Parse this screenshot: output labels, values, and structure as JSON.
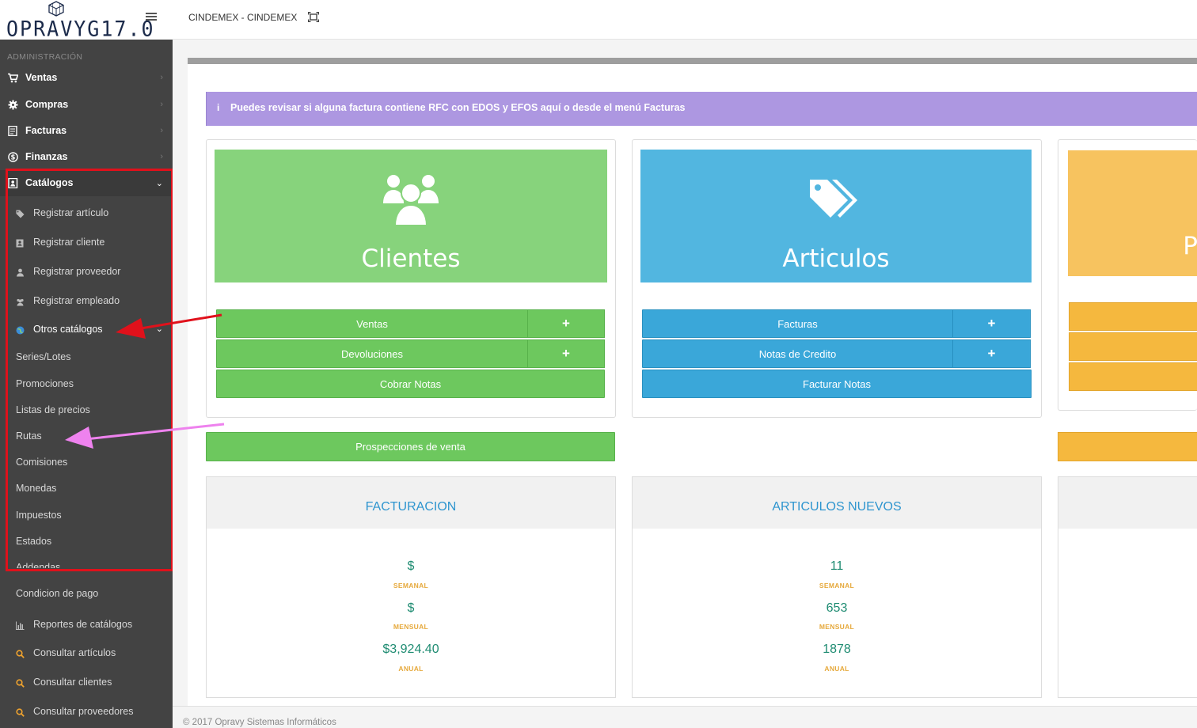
{
  "topbar": {
    "logo_text": "OPRAVYG17.0",
    "company": "CINDEMEX - CINDEMEX",
    "hamburger_icon": "hamburger-menu-icon",
    "fullscreen_icon": "fullscreen-icon"
  },
  "sidebar": {
    "header": "ADMINISTRACIÓN",
    "items": [
      {
        "label": "Ventas",
        "icon": "cart-icon"
      },
      {
        "label": "Compras",
        "icon": "gear-icon"
      },
      {
        "label": "Facturas",
        "icon": "invoice-icon"
      },
      {
        "label": "Finanzas",
        "icon": "dollar-icon"
      },
      {
        "label": "Catálogos",
        "icon": "catalog-icon"
      }
    ],
    "catalog_sub": [
      {
        "label": "Registrar artículo",
        "icon": "tags-icon"
      },
      {
        "label": "Registrar cliente",
        "icon": "address-book-icon"
      },
      {
        "label": "Registrar proveedor",
        "icon": "user-icon"
      },
      {
        "label": "Registrar empleado",
        "icon": "users-icon"
      },
      {
        "label": "Otros catálogos",
        "icon": "globe-icon"
      }
    ],
    "otros": [
      "Series/Lotes",
      "Promociones",
      "Listas de precios",
      "Rutas",
      "Comisiones",
      "Monedas",
      "Impuestos",
      "Estados",
      "Addendas",
      "Condicion de pago"
    ],
    "reports": [
      {
        "label": "Reportes de catálogos",
        "icon": "bar-chart-icon"
      },
      {
        "label": "Consultar artículos",
        "icon": "search-icon"
      },
      {
        "label": "Consultar clientes",
        "icon": "search-icon"
      },
      {
        "label": "Consultar proveedores",
        "icon": "search-icon"
      }
    ]
  },
  "alert": {
    "icon": "i",
    "text": "Puedes revisar si alguna factura contiene RFC con EDOS y EFOS aquí o desde el menú Facturas"
  },
  "cards": {
    "clientes": {
      "title": "Clientes",
      "btn_ventas": "Ventas",
      "btn_devoluciones": "Devoluciones",
      "btn_cobrar": "Cobrar Notas",
      "btn_prospecciones": "Prospecciones de venta",
      "plus": "+"
    },
    "articulos": {
      "title": "Articulos",
      "btn_facturas": "Facturas",
      "btn_notas": "Notas de Credito",
      "btn_facturar": "Facturar Notas",
      "plus": "+"
    },
    "third": {
      "title": "P"
    }
  },
  "stats": {
    "facturacion": {
      "title": "FACTURACION",
      "semanal": "$",
      "mensual": "$",
      "anual": "$3,924.40"
    },
    "articulos": {
      "title": "ARTICULOS NUEVOS",
      "semanal": "11",
      "mensual": "653",
      "anual": "1878"
    },
    "labels": {
      "semanal": "SEMANAL",
      "mensual": "MENSUAL",
      "anual": "ANUAL"
    }
  },
  "footer": "© 2017 Opravy Sistemas Informáticos",
  "colors": {
    "green": "#6dc85e",
    "blue": "#3aa7d9",
    "orange": "#f5b83e",
    "alert": "#ad97e1",
    "sidebar": "#434343",
    "annotation_red": "#e0111b",
    "annotation_pink": "#ee82ee"
  }
}
